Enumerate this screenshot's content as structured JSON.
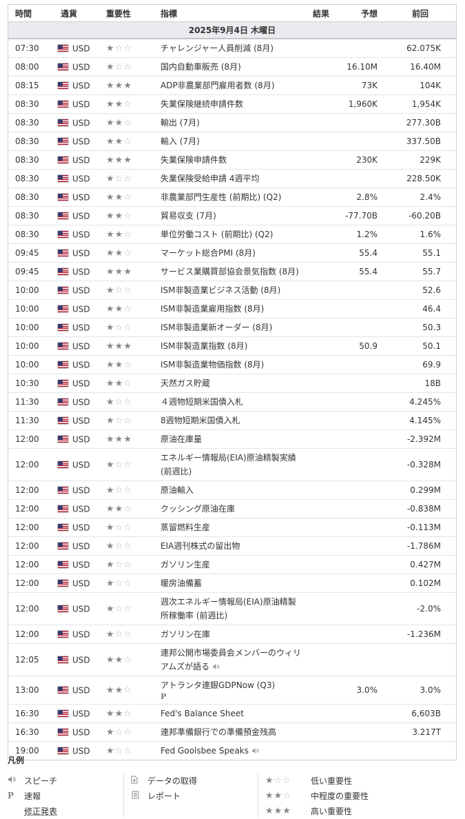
{
  "columns": {
    "time": "時間",
    "currency": "通貨",
    "importance": "重要性",
    "event": "指標",
    "actual": "結果",
    "forecast": "予想",
    "previous": "前回"
  },
  "date": "2025年9月4日 木曜日",
  "events": [
    {
      "time": "07:30",
      "currency": "USD",
      "importance": 1,
      "name": "チャレンジャー人員削減 (8月)",
      "actual": "",
      "forecast": "",
      "previous": "62.075K"
    },
    {
      "time": "08:00",
      "currency": "USD",
      "importance": 1,
      "name": "国内自動車販売 (8月)",
      "actual": "",
      "forecast": "16.10M",
      "previous": "16.40M"
    },
    {
      "time": "08:15",
      "currency": "USD",
      "importance": 3,
      "name": "ADP非農業部門雇用者数 (8月)",
      "actual": "",
      "forecast": "73K",
      "previous": "104K"
    },
    {
      "time": "08:30",
      "currency": "USD",
      "importance": 2,
      "name": "失業保険継続申請件数",
      "actual": "",
      "forecast": "1,960K",
      "previous": "1,954K"
    },
    {
      "time": "08:30",
      "currency": "USD",
      "importance": 2,
      "name": "輸出 (7月)",
      "actual": "",
      "forecast": "",
      "previous": "277.30B"
    },
    {
      "time": "08:30",
      "currency": "USD",
      "importance": 2,
      "name": "輸入 (7月)",
      "actual": "",
      "forecast": "",
      "previous": "337.50B"
    },
    {
      "time": "08:30",
      "currency": "USD",
      "importance": 3,
      "name": "失業保険申請件数",
      "actual": "",
      "forecast": "230K",
      "previous": "229K"
    },
    {
      "time": "08:30",
      "currency": "USD",
      "importance": 1,
      "name": "失業保険受給申請 4週平均",
      "actual": "",
      "forecast": "",
      "previous": "228.50K"
    },
    {
      "time": "08:30",
      "currency": "USD",
      "importance": 2,
      "name": "非農業部門生産性 (前期比) (Q2)",
      "actual": "",
      "forecast": "2.8%",
      "previous": "2.4%"
    },
    {
      "time": "08:30",
      "currency": "USD",
      "importance": 2,
      "name": "貿易収支 (7月)",
      "actual": "",
      "forecast": "-77.70B",
      "previous": "-60.20B"
    },
    {
      "time": "08:30",
      "currency": "USD",
      "importance": 2,
      "name": "単位労働コスト (前期比) (Q2)",
      "actual": "",
      "forecast": "1.2%",
      "previous": "1.6%"
    },
    {
      "time": "09:45",
      "currency": "USD",
      "importance": 2,
      "name": "マーケット総合PMI (8月)",
      "actual": "",
      "forecast": "55.4",
      "previous": "55.1"
    },
    {
      "time": "09:45",
      "currency": "USD",
      "importance": 3,
      "name": "サービス業購買部協会景気指数 (8月)",
      "actual": "",
      "forecast": "55.4",
      "previous": "55.7"
    },
    {
      "time": "10:00",
      "currency": "USD",
      "importance": 1,
      "name": "ISM非製造業ビジネス活動 (8月)",
      "actual": "",
      "forecast": "",
      "previous": "52.6"
    },
    {
      "time": "10:00",
      "currency": "USD",
      "importance": 2,
      "name": "ISM非製造業雇用指数 (8月)",
      "actual": "",
      "forecast": "",
      "previous": "46.4"
    },
    {
      "time": "10:00",
      "currency": "USD",
      "importance": 1,
      "name": "ISM非製造業新オーダー (8月)",
      "actual": "",
      "forecast": "",
      "previous": "50.3"
    },
    {
      "time": "10:00",
      "currency": "USD",
      "importance": 3,
      "name": "ISM非製造業指数 (8月)",
      "actual": "",
      "forecast": "50.9",
      "previous": "50.1"
    },
    {
      "time": "10:00",
      "currency": "USD",
      "importance": 2,
      "name": "ISM非製造業物価指数 (8月)",
      "actual": "",
      "forecast": "",
      "previous": "69.9"
    },
    {
      "time": "10:30",
      "currency": "USD",
      "importance": 2,
      "name": "天然ガス貯蔵",
      "actual": "",
      "forecast": "",
      "previous": "18B"
    },
    {
      "time": "11:30",
      "currency": "USD",
      "importance": 1,
      "name": "４週物短期米国債入札",
      "actual": "",
      "forecast": "",
      "previous": "4.245%"
    },
    {
      "time": "11:30",
      "currency": "USD",
      "importance": 1,
      "name": "8週物短期米国債入札",
      "actual": "",
      "forecast": "",
      "previous": "4.145%"
    },
    {
      "time": "12:00",
      "currency": "USD",
      "importance": 3,
      "name": "原油在庫量",
      "actual": "",
      "forecast": "",
      "previous": "-2.392M"
    },
    {
      "time": "12:00",
      "currency": "USD",
      "importance": 1,
      "name": "エネルギー情報局(EIA)原油精製実績 (前週比)",
      "actual": "",
      "forecast": "",
      "previous": "-0.328M"
    },
    {
      "time": "12:00",
      "currency": "USD",
      "importance": 1,
      "name": "原油輸入",
      "actual": "",
      "forecast": "",
      "previous": "0.299M"
    },
    {
      "time": "12:00",
      "currency": "USD",
      "importance": 2,
      "name": "クッシング原油在庫",
      "actual": "",
      "forecast": "",
      "previous": "-0.838M"
    },
    {
      "time": "12:00",
      "currency": "USD",
      "importance": 1,
      "name": "蒸留燃料生産",
      "actual": "",
      "forecast": "",
      "previous": "-0.113M"
    },
    {
      "time": "12:00",
      "currency": "USD",
      "importance": 1,
      "name": "EIA週刊株式の留出物",
      "actual": "",
      "forecast": "",
      "previous": "-1.786M"
    },
    {
      "time": "12:00",
      "currency": "USD",
      "importance": 1,
      "name": "ガソリン生産",
      "actual": "",
      "forecast": "",
      "previous": "0.427M"
    },
    {
      "time": "12:00",
      "currency": "USD",
      "importance": 1,
      "name": "暖房油備蓄",
      "actual": "",
      "forecast": "",
      "previous": "0.102M"
    },
    {
      "time": "12:00",
      "currency": "USD",
      "importance": 1,
      "name": "週次エネルギー情報局(EIA)原油精製所稼働率 (前週比)",
      "actual": "",
      "forecast": "",
      "previous": "-2.0%"
    },
    {
      "time": "12:00",
      "currency": "USD",
      "importance": 1,
      "name": "ガソリン在庫",
      "actual": "",
      "forecast": "",
      "previous": "-1.236M"
    },
    {
      "time": "12:05",
      "currency": "USD",
      "importance": 2,
      "name": "連邦公開市場委員会メンバーのウィリアムズが語る",
      "speech": true,
      "actual": "",
      "forecast": "",
      "previous": ""
    },
    {
      "time": "13:00",
      "currency": "USD",
      "importance": 2,
      "name": "アトランタ連銀GDPNow (Q3)",
      "prelim": true,
      "actual": "",
      "forecast": "3.0%",
      "previous": "3.0%"
    },
    {
      "time": "16:30",
      "currency": "USD",
      "importance": 2,
      "name": "Fed's Balance Sheet",
      "actual": "",
      "forecast": "",
      "previous": "6,603B"
    },
    {
      "time": "16:30",
      "currency": "USD",
      "importance": 1,
      "name": "連邦準備銀行での準備預金残高",
      "actual": "",
      "forecast": "",
      "previous": "3.217T"
    },
    {
      "time": "19:00",
      "currency": "USD",
      "importance": 1,
      "name": "Fed Goolsbee Speaks",
      "speech": true,
      "actual": "",
      "forecast": "",
      "previous": ""
    }
  ],
  "legend": {
    "title": "凡例",
    "speech": "スピーチ",
    "prelim": "速報",
    "revised": "修正発表",
    "data_fetch": "データの取得",
    "report": "レポート",
    "low": "低い重要性",
    "medium": "中程度の重要性",
    "high": "高い重要性",
    "prelim_mark": "P"
  },
  "colors": {
    "date_bg": "#e9ebee",
    "star_on": "#888888",
    "star_off": "#bbbbbb",
    "border": "#cfcfcf"
  }
}
